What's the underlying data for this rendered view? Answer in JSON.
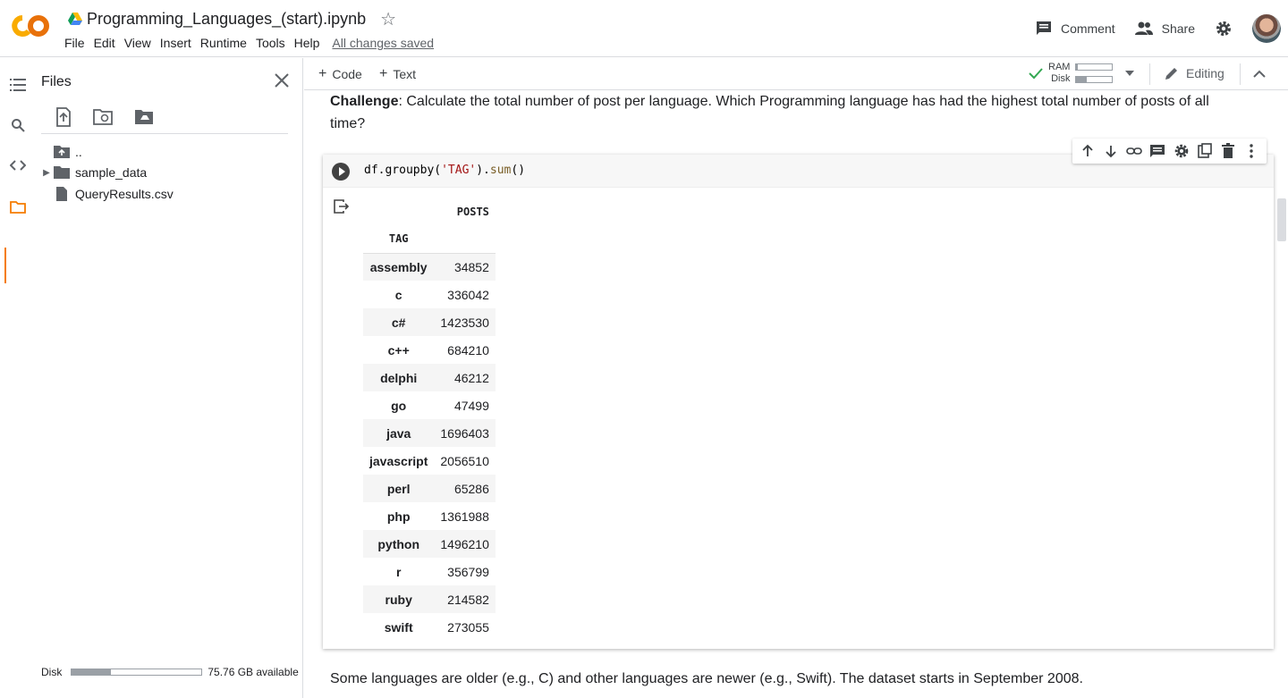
{
  "header": {
    "notebook_title": "Programming_Languages_(start).ipynb",
    "menu": [
      "File",
      "Edit",
      "View",
      "Insert",
      "Runtime",
      "Tools",
      "Help"
    ],
    "save_status": "All changes saved",
    "comment_label": "Comment",
    "share_label": "Share"
  },
  "files_panel": {
    "title": "Files",
    "items": [
      {
        "name": "..",
        "type": "parent-folder"
      },
      {
        "name": "sample_data",
        "type": "folder"
      },
      {
        "name": "QueryResults.csv",
        "type": "file"
      }
    ],
    "disk_label": "Disk",
    "disk_available": "75.76 GB available",
    "disk_used_fraction": 0.3
  },
  "toolbar": {
    "code_label": "Code",
    "text_label": "Text",
    "ram_label": "RAM",
    "disk_label": "Disk",
    "ram_used_fraction": 0.05,
    "disk_used_fraction": 0.3,
    "editing_label": "Editing"
  },
  "notebook": {
    "challenge_bold": "Challenge",
    "challenge_text": ": Calculate the total number of post per language. Which Programming language has had the highest total number of posts of all time?",
    "code": {
      "prefix": "df.groupby(",
      "arg": "'TAG'",
      "mid": ").",
      "fn": "sum",
      "suffix": "()"
    },
    "output": {
      "column_header": "POSTS",
      "index_header": "TAG",
      "rows": [
        {
          "tag": "assembly",
          "posts": "34852"
        },
        {
          "tag": "c",
          "posts": "336042"
        },
        {
          "tag": "c#",
          "posts": "1423530"
        },
        {
          "tag": "c++",
          "posts": "684210"
        },
        {
          "tag": "delphi",
          "posts": "46212"
        },
        {
          "tag": "go",
          "posts": "47499"
        },
        {
          "tag": "java",
          "posts": "1696403"
        },
        {
          "tag": "javascript",
          "posts": "2056510"
        },
        {
          "tag": "perl",
          "posts": "65286"
        },
        {
          "tag": "php",
          "posts": "1361988"
        },
        {
          "tag": "python",
          "posts": "1496210"
        },
        {
          "tag": "r",
          "posts": "356799"
        },
        {
          "tag": "ruby",
          "posts": "214582"
        },
        {
          "tag": "swift",
          "posts": "273055"
        }
      ]
    },
    "next_text": "Some languages are older (e.g., C) and other languages are newer (e.g., Swift). The dataset starts in September 2008."
  },
  "colors": {
    "accent": "#f57c00",
    "check": "#34a853"
  }
}
